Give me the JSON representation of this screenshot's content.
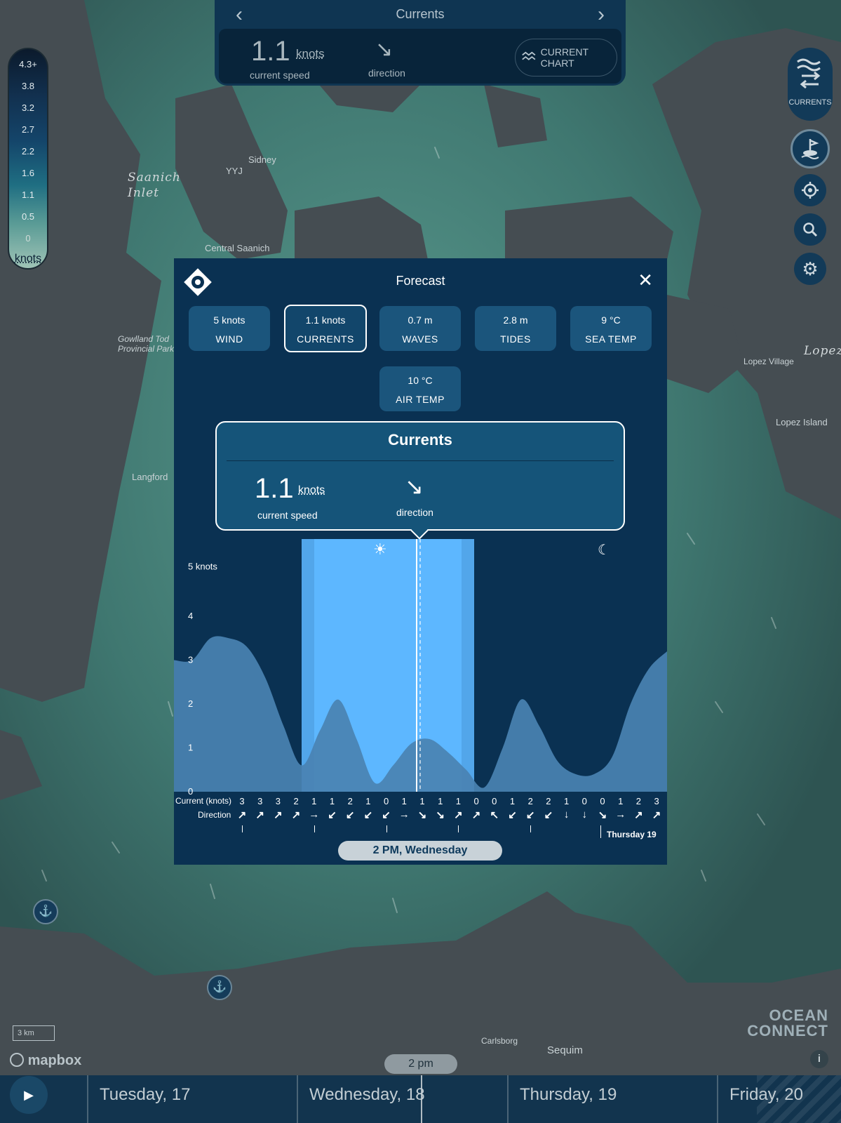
{
  "top_panel": {
    "title": "Currents",
    "speed": "1.1",
    "speed_unit": "knots",
    "speed_label": "current speed",
    "direction_label": "direction",
    "direction_arrow": "↘",
    "chart_button": "CURRENT CHART",
    "prev_icon": "chevron-left-icon",
    "next_icon": "chevron-right-icon"
  },
  "legend": {
    "values": [
      "4.3+",
      "3.8",
      "3.2",
      "2.7",
      "2.2",
      "1.6",
      "1.1",
      "0.5",
      "0"
    ],
    "unit": "knots"
  },
  "right_controls": {
    "layer_label": "CURRENTS"
  },
  "map_labels": {
    "saanich": "Saanich\nInlet",
    "sidney": "Sidney",
    "yyj": "YYJ",
    "central_saanich": "Central Saanich",
    "gowlland": "Gowlland Tod\nProvincial Park",
    "langford": "Langford",
    "lopez_village": "Lopez Village",
    "lopez_island": "Lopez Island",
    "lopez": "Lopez",
    "carlsborg": "Carlsborg",
    "sequim": "Sequim"
  },
  "modal": {
    "title": "Forecast",
    "chips": [
      {
        "value": "5 knots",
        "label": "WIND"
      },
      {
        "value": "1.1 knots",
        "label": "CURRENTS"
      },
      {
        "value": "0.7 m",
        "label": "WAVES"
      },
      {
        "value": "2.8 m",
        "label": "TIDES"
      },
      {
        "value": "9 °C",
        "label": "SEA TEMP"
      },
      {
        "value": "10 °C",
        "label": "AIR TEMP"
      }
    ],
    "tooltip": {
      "title": "Currents",
      "speed": "1.1",
      "unit": "knots",
      "speed_label": "current speed",
      "direction_arrow": "↘",
      "direction_label": "direction"
    },
    "row_current_label": "Current (knots)",
    "row_direction_label": "Direction",
    "day_label": "Thursday 19",
    "time_pill": "2 PM, Wednesday"
  },
  "chart_data": {
    "type": "area",
    "ylabel": "",
    "y_ticks": [
      "5 knots",
      "4",
      "3",
      "2",
      "1",
      "0"
    ],
    "ylim": [
      0,
      5
    ],
    "x": [
      0,
      1,
      2,
      3,
      4,
      5,
      6,
      7,
      8,
      9,
      10,
      11,
      12,
      13,
      14,
      15,
      16,
      17,
      18,
      19,
      20,
      21,
      22,
      23,
      24,
      25,
      26,
      27
    ],
    "series": [
      {
        "values": [
          3.0,
          3.0,
          3.5,
          3.5,
          3.3,
          2.6,
          1.5,
          0.6,
          1.4,
          2.1,
          1.2,
          0.2,
          0.6,
          1.1,
          1.2,
          0.9,
          0.5,
          0.1,
          1.0,
          2.1,
          1.5,
          0.7,
          0.4,
          0.4,
          0.8,
          2.0,
          2.8,
          3.2
        ]
      }
    ],
    "current_row": [
      "3",
      "3",
      "3",
      "2",
      "1",
      "1",
      "2",
      "1",
      "0",
      "1",
      "1",
      "1",
      "1",
      "0",
      "0",
      "1",
      "2",
      "2",
      "1",
      "0",
      "0",
      "1",
      "2",
      "3"
    ],
    "direction_row": [
      "↗",
      "↗",
      "↗",
      "↗",
      "→",
      "↙",
      "↙",
      "↙",
      "↙",
      "→",
      "↘",
      "↘",
      "↗",
      "↗",
      "↖",
      "↙",
      "↙",
      "↙",
      "↓",
      "↓",
      "↘",
      "→",
      "↗",
      "↗"
    ],
    "daylight_window": [
      10.0,
      23.7
    ],
    "selected_x": 19.3
  },
  "timeline": {
    "now_pill": "2 pm",
    "days": [
      "Tuesday, 17",
      "Wednesday, 18",
      "Thursday, 19",
      "Friday, 20"
    ]
  },
  "attribution": {
    "mapbox": "mapbox",
    "scale": "3 km",
    "brand_line1": "OCEAN",
    "brand_line2": "CONNECT",
    "info": "i"
  },
  "colors": {
    "modal_bg": "#0a3152",
    "chip_bg": "#1b557c",
    "area_fill": "#4a82b2",
    "daylight": "#5db7ff",
    "daylight_edge": "#52a6ea"
  }
}
